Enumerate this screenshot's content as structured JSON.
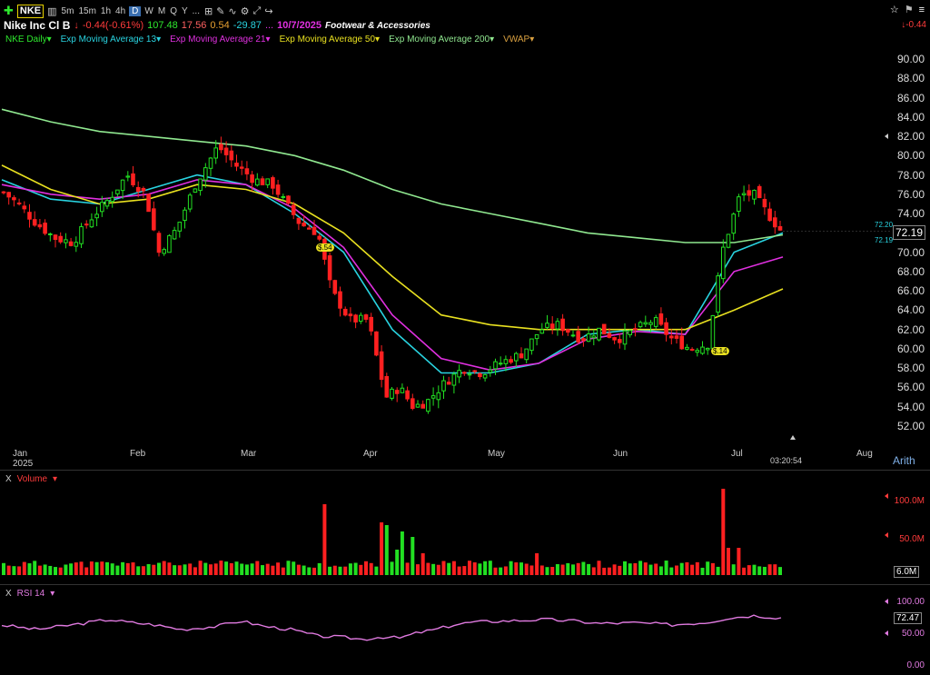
{
  "toolbar": {
    "symbol": "NKE",
    "timeframes": [
      "5m",
      "15m",
      "1h",
      "4h",
      "D",
      "W",
      "M",
      "Q",
      "Y"
    ],
    "active_timeframe": "D",
    "dots": "..."
  },
  "quote": {
    "name": "Nike Inc Cl B",
    "change": "-0.44(-0.61%)",
    "volume": "107.48",
    "v2": "17.56",
    "v3": "0.54",
    "v4": "-29.87",
    "dots": "...",
    "date": "10/7/2025",
    "industry": "Footwear & Accessories",
    "right_change": "-0.44"
  },
  "indicators": [
    {
      "label": "NKE Daily",
      "color": "#2ee82e"
    },
    {
      "label": "Exp Moving Average 13",
      "color": "#29d3e0"
    },
    {
      "label": "Exp Moving Average 21",
      "color": "#e030e0"
    },
    {
      "label": "Exp Moving Average 50",
      "color": "#e8e020"
    },
    {
      "label": "Exp Moving Average 200",
      "color": "#90e890"
    },
    {
      "label": "VWAP",
      "color": "#d9a040"
    }
  ],
  "price_axis": [
    "90.00",
    "88.00",
    "86.00",
    "84.00",
    "82.00",
    "80.00",
    "78.00",
    "76.00",
    "74.00",
    "72.00",
    "70.00",
    "68.00",
    "66.00",
    "64.00",
    "62.00",
    "60.00",
    "58.00",
    "56.00",
    "54.00",
    "52.00"
  ],
  "last_price": "72.19",
  "tag_upper": "72.20",
  "tag_lower": "72.19",
  "months": [
    {
      "label": "Jan",
      "sub": "2025"
    },
    {
      "label": "Feb",
      "sub": ""
    },
    {
      "label": "Mar",
      "sub": ""
    },
    {
      "label": "Apr",
      "sub": ""
    },
    {
      "label": "May",
      "sub": ""
    },
    {
      "label": "Jun",
      "sub": ""
    },
    {
      "label": "Jul",
      "sub": ""
    },
    {
      "label": "Aug",
      "sub": ""
    }
  ],
  "countdown": "03:20:54",
  "scale_mode": "Arith",
  "markers": [
    "$.54",
    "$.14"
  ],
  "volume_pane": {
    "close": "X",
    "title": "Volume",
    "axis": [
      "100.0M",
      "50.0M"
    ],
    "last": "6.0M"
  },
  "rsi_pane": {
    "close": "X",
    "title": "RSI 14",
    "axis": [
      "100.00",
      "50.00",
      "0.00"
    ],
    "last": "72.47"
  },
  "colors": {
    "up": "#22e022",
    "down": "#ff2020",
    "ema13": "#29d3e0",
    "ema21": "#e030e0",
    "ema50": "#e8e020",
    "ema200": "#90e890",
    "rsi": "#e07ae0"
  },
  "chart_data": {
    "type": "line",
    "title": "Nike Inc Cl B",
    "xlabel": "",
    "ylabel": "",
    "ylim": [
      52,
      90
    ],
    "series": [
      {
        "name": "Exp Moving Average 13",
        "values": [
          77.5,
          75.5,
          75.0,
          76.5,
          78.0,
          77.0,
          74.0,
          70.0,
          62.0,
          57.5,
          57.5,
          58.5,
          61.5,
          62.0,
          61.5,
          70.0,
          72.0
        ]
      },
      {
        "name": "Exp Moving Average 21",
        "values": [
          77.0,
          76.0,
          75.5,
          76.0,
          77.5,
          77.0,
          74.5,
          70.5,
          63.5,
          59.0,
          57.8,
          58.5,
          61.0,
          61.8,
          61.5,
          68.0,
          69.5
        ]
      },
      {
        "name": "Exp Moving Average 50",
        "values": [
          79.0,
          76.5,
          75.0,
          75.5,
          77.0,
          76.5,
          75.0,
          72.0,
          67.5,
          63.5,
          62.5,
          62.0,
          62.0,
          62.0,
          62.0,
          64.0,
          66.2
        ]
      },
      {
        "name": "Exp Moving Average 200",
        "values": [
          84.8,
          83.5,
          82.5,
          82.0,
          81.5,
          81.0,
          80.0,
          78.5,
          76.5,
          75.0,
          74.0,
          73.0,
          72.0,
          71.5,
          71.0,
          71.0,
          71.8
        ]
      }
    ]
  }
}
